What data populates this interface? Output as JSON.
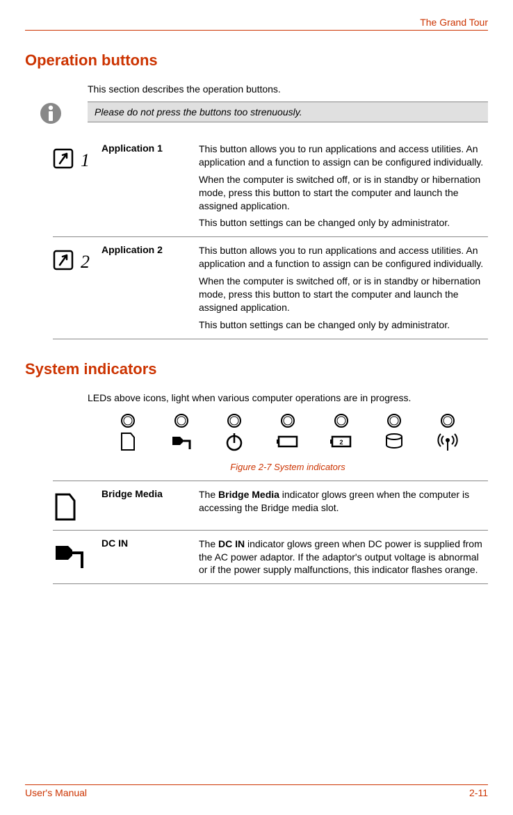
{
  "header": {
    "right": "The Grand Tour"
  },
  "sections": {
    "operation_buttons": {
      "title": "Operation buttons",
      "intro": "This section describes the operation buttons.",
      "note": "Please do not press the buttons too strenuously.",
      "items": [
        {
          "label": "Application 1",
          "num": "1",
          "paras": [
            "This button allows you to run applications and access utilities. An application and a function to assign can be configured individually.",
            "When the computer is switched off, or is in standby or hibernation mode, press this button to start the computer and launch the assigned application.",
            "This button settings can be changed only by administrator."
          ]
        },
        {
          "label": "Application 2",
          "num": "2",
          "paras": [
            "This button allows you to run applications and access utilities. An application and a function to assign can be configured individually.",
            "When the computer is switched off, or is in standby or hibernation mode, press this button to start the computer and launch the assigned application.",
            "This button settings can be changed only by administrator."
          ]
        }
      ]
    },
    "system_indicators": {
      "title": "System indicators",
      "intro": "LEDs above icons, light when various computer operations are in progress.",
      "caption": "Figure 2-7 System indicators",
      "items": [
        {
          "label": "Bridge Media",
          "bold_term": "Bridge Media",
          "text_before": "The ",
          "text_after": " indicator glows green when the computer is accessing the Bridge media slot."
        },
        {
          "label": "DC IN",
          "bold_term": "DC IN",
          "text_before": "The ",
          "text_after": " indicator glows green when DC power is supplied from the AC power adaptor. If the adaptor's output voltage is abnormal or if the power supply malfunctions, this indicator flashes orange."
        }
      ]
    }
  },
  "footer": {
    "left": "User's Manual",
    "right": "2-11"
  }
}
